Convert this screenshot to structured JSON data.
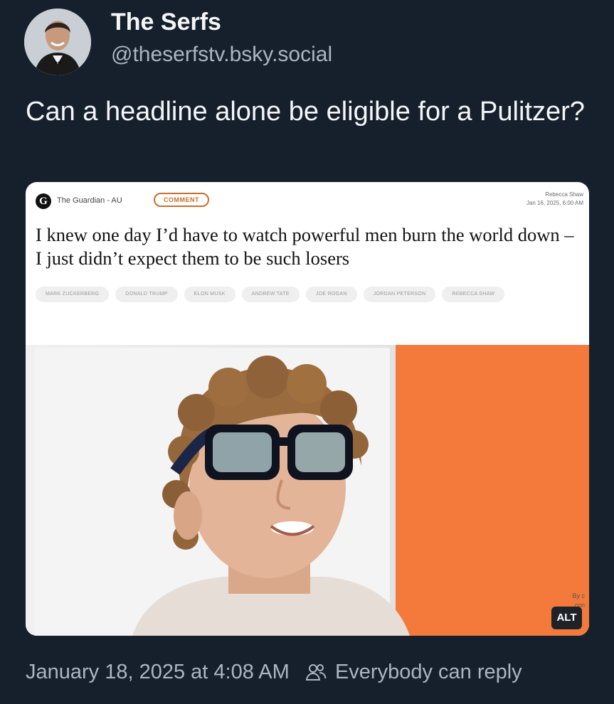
{
  "author": {
    "name": "The Serfs",
    "handle": "@theserfstv.bsky.social"
  },
  "post": {
    "text": "Can a headline alone be eligible for a Pulitzer?"
  },
  "embed": {
    "source": "The Guardian - AU",
    "badge": "COMMENT",
    "byline_author": "Rebecca Shaw",
    "byline_date": "Jan 16, 2025, 6:00 AM",
    "headline": "I knew one day I’d have to watch powerful men burn the world down – I just didn’t expect them to be such losers",
    "tags": [
      "MARK ZUCKERBERG",
      "DONALD TRUMP",
      "ELON MUSK",
      "ANDREW TATE",
      "JOE ROGAN",
      "JORDAN PETERSON",
      "REBECCA SHAW"
    ],
    "overlay_line1": "By c",
    "overlay_line2": "con",
    "alt_label": "ALT",
    "accent_color": "#f47a3c"
  },
  "footer": {
    "timestamp": "January 18, 2025 at 4:08 AM",
    "reply_setting": "Everybody can reply",
    "reply_icon": "people-icon"
  },
  "colors": {
    "background": "#16202c",
    "secondary_text": "#aab6c3"
  }
}
